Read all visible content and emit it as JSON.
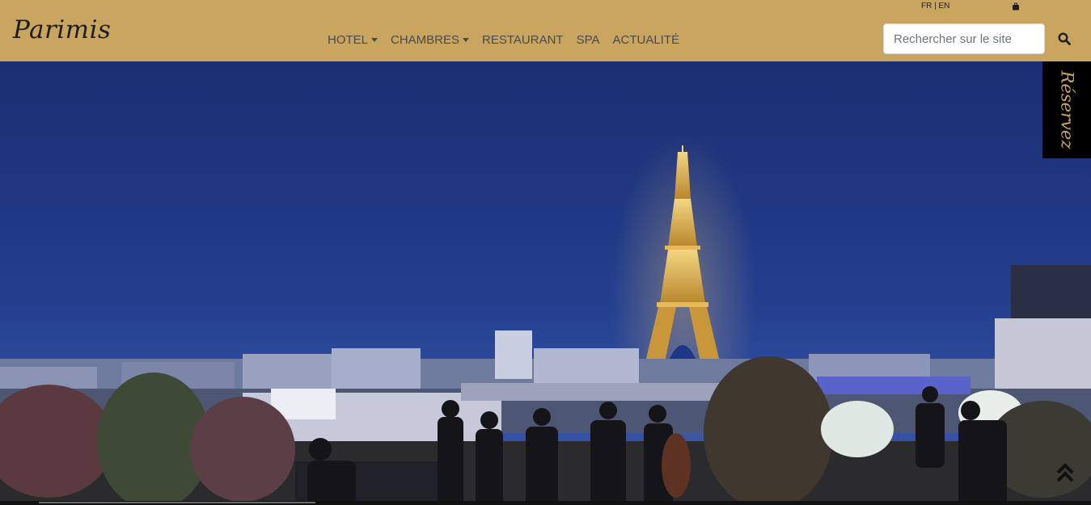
{
  "brand": {
    "logo_text": "Parimis",
    "accent_color": "#c9a560"
  },
  "language": {
    "fr": "FR",
    "separator": "|",
    "en": "EN"
  },
  "header": {
    "bag_icon": "shopping-bag-icon"
  },
  "nav": {
    "items": [
      {
        "label": "HOTEL",
        "has_dropdown": true
      },
      {
        "label": "CHAMBRES",
        "has_dropdown": true
      },
      {
        "label": "RESTAURANT",
        "has_dropdown": false
      },
      {
        "label": "SPA",
        "has_dropdown": false
      },
      {
        "label": "ACTUALITÉ",
        "has_dropdown": false
      }
    ]
  },
  "search": {
    "placeholder": "Rechercher sur le site",
    "value": "",
    "icon": "search-icon"
  },
  "reserve": {
    "label": "Réservez"
  },
  "hero": {
    "alt": "Terrasse sur les toits de Paris au crépuscule avec la Tour Eiffel illuminée et un orchestre de jazz"
  },
  "scroll": {
    "icon": "double-chevron-up-icon"
  }
}
